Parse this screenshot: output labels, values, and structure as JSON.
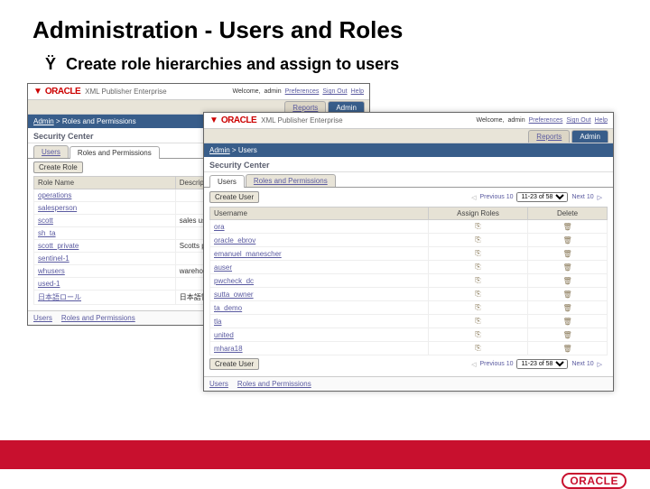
{
  "slide": {
    "title": "Administration - Users and Roles",
    "bullet_symbol": "Ÿ",
    "bullet_text": "Create role hierarchies and assign to users"
  },
  "panel1": {
    "brand_product": "XML Publisher Enterprise",
    "welcome_prefix": "Welcome,",
    "welcome_user": "admin",
    "links": {
      "prefs": "Preferences",
      "signout": "Sign Out",
      "help": "Help"
    },
    "main_tabs": {
      "reports": "Reports",
      "admin": "Admin"
    },
    "breadcrumb_root": "Admin",
    "breadcrumb_leaf": "Roles and Permissions",
    "section": "Security Center",
    "subtabs": {
      "users": "Users",
      "roles": "Roles and Permissions"
    },
    "create_btn": "Create Role",
    "cols": {
      "name": "Role Name",
      "desc": "Description"
    },
    "rows": [
      {
        "name": "operations",
        "desc": ""
      },
      {
        "name": "salesperson",
        "desc": ""
      },
      {
        "name": "scott",
        "desc": "sales users"
      },
      {
        "name": "sh_ta",
        "desc": ""
      },
      {
        "name": "scott_private",
        "desc": "Scotts private area"
      },
      {
        "name": "sentinel-1",
        "desc": ""
      },
      {
        "name": "whusers",
        "desc": "warehouse users"
      },
      {
        "name": "used-1",
        "desc": ""
      },
      {
        "name": "日本語ロール",
        "desc": "日本語管理ロール"
      }
    ]
  },
  "panel2": {
    "brand_product": "XML Publisher Enterprise",
    "welcome_prefix": "Welcome,",
    "welcome_user": "admin",
    "links": {
      "prefs": "Preferences",
      "signout": "Sign Out",
      "help": "Help"
    },
    "main_tabs": {
      "reports": "Reports",
      "admin": "Admin"
    },
    "breadcrumb_root": "Admin",
    "breadcrumb_leaf": "Users",
    "section": "Security Center",
    "subtabs": {
      "users": "Users",
      "roles": "Roles and Permissions"
    },
    "create_btn": "Create User",
    "pager": {
      "prev": "Previous 10",
      "range": "11-23 of 58",
      "next": "Next 10"
    },
    "cols": {
      "user": "Username",
      "assign": "Assign Roles",
      "del": "Delete"
    },
    "rows": [
      {
        "name": "ora"
      },
      {
        "name": "oracle_ebrov"
      },
      {
        "name": "emanuel_manescher"
      },
      {
        "name": "auser"
      },
      {
        "name": "pwcheck_dc"
      },
      {
        "name": "sutta_owner"
      },
      {
        "name": "ta_demo"
      },
      {
        "name": "tla"
      },
      {
        "name": "united"
      },
      {
        "name": "mhara18"
      }
    ]
  },
  "footer": {
    "brand": "ORACLE"
  }
}
